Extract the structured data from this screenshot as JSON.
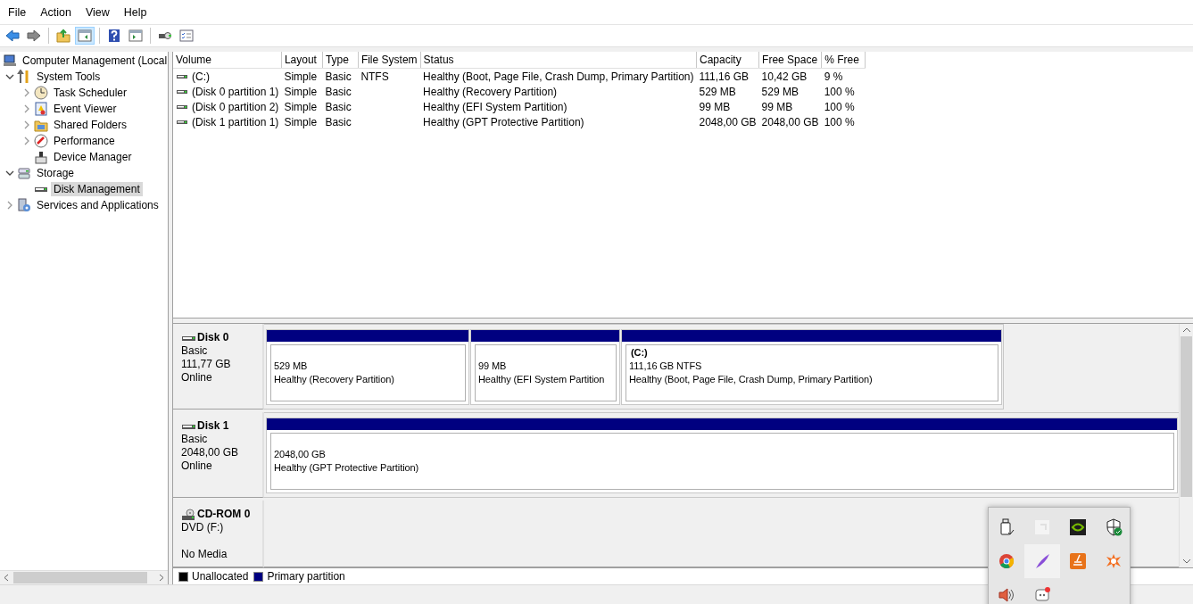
{
  "menu": [
    {
      "label": "File"
    },
    {
      "label": "Action"
    },
    {
      "label": "View"
    },
    {
      "label": "Help"
    }
  ],
  "tree": [
    {
      "kind": "root",
      "label": "Computer Management (Local",
      "selected": false,
      "children": [
        {
          "kind": "branch",
          "label": "System Tools",
          "expanded": true,
          "selected": false,
          "children": [
            {
              "kind": "branch",
              "label": "Task Scheduler",
              "expanded": false,
              "selected": false
            },
            {
              "kind": "branch",
              "label": "Event Viewer",
              "expanded": false,
              "selected": false
            },
            {
              "kind": "branch",
              "label": "Shared Folders",
              "expanded": false,
              "selected": false
            },
            {
              "kind": "branch",
              "label": "Performance",
              "expanded": false,
              "selected": false
            },
            {
              "kind": "leaf",
              "label": "Device Manager",
              "selected": false
            }
          ]
        },
        {
          "kind": "branch",
          "label": "Storage",
          "expanded": true,
          "selected": false,
          "children": [
            {
              "kind": "leaf",
              "label": "Disk Management",
              "selected": true
            }
          ]
        },
        {
          "kind": "branch",
          "label": "Services and Applications",
          "expanded": false,
          "selected": false
        }
      ]
    }
  ],
  "table": {
    "columns": [
      "Volume",
      "Layout",
      "Type",
      "File System",
      "Status",
      "Capacity",
      "Free Space",
      "% Free"
    ],
    "rows": [
      [
        "(C:)",
        "Simple",
        "Basic",
        "NTFS",
        "Healthy (Boot, Page File, Crash Dump, Primary Partition)",
        "111,16 GB",
        "10,42 GB",
        "9 %"
      ],
      [
        "(Disk 0 partition 1)",
        "Simple",
        "Basic",
        "",
        "Healthy (Recovery Partition)",
        "529 MB",
        "529 MB",
        "100 %"
      ],
      [
        "(Disk 0 partition 2)",
        "Simple",
        "Basic",
        "",
        "Healthy (EFI System Partition)",
        "99 MB",
        "99 MB",
        "100 %"
      ],
      [
        "(Disk 1 partition 1)",
        "Simple",
        "Basic",
        "",
        "Healthy (GPT Protective Partition)",
        "2048,00 GB",
        "2048,00 GB",
        "100 %"
      ]
    ]
  },
  "disks": [
    {
      "kind": "disk",
      "name": "Disk 0",
      "type": "Basic",
      "size": "111,77 GB",
      "status": "Online",
      "partitions": [
        {
          "size": "529 MB",
          "status": "Healthy (Recovery Partition)"
        },
        {
          "size": "99 MB",
          "status": "Healthy (EFI System Partition"
        },
        {
          "label": "(C:)",
          "size": "111,16 GB NTFS",
          "status": "Healthy (Boot, Page File, Crash Dump, Primary Partition)"
        }
      ]
    },
    {
      "kind": "disk",
      "name": "Disk 1",
      "type": "Basic",
      "size": "2048,00 GB",
      "status": "Online",
      "partitions": [
        {
          "size": "2048,00 GB",
          "status": "Healthy (GPT Protective Partition)"
        }
      ]
    },
    {
      "kind": "cdrom",
      "name": "CD-ROM 0",
      "type": "DVD (F:)",
      "status": "No Media"
    }
  ],
  "legend": [
    {
      "label": "Unallocated",
      "color": "#000000"
    },
    {
      "label": "Primary partition",
      "color": "#000080"
    }
  ]
}
